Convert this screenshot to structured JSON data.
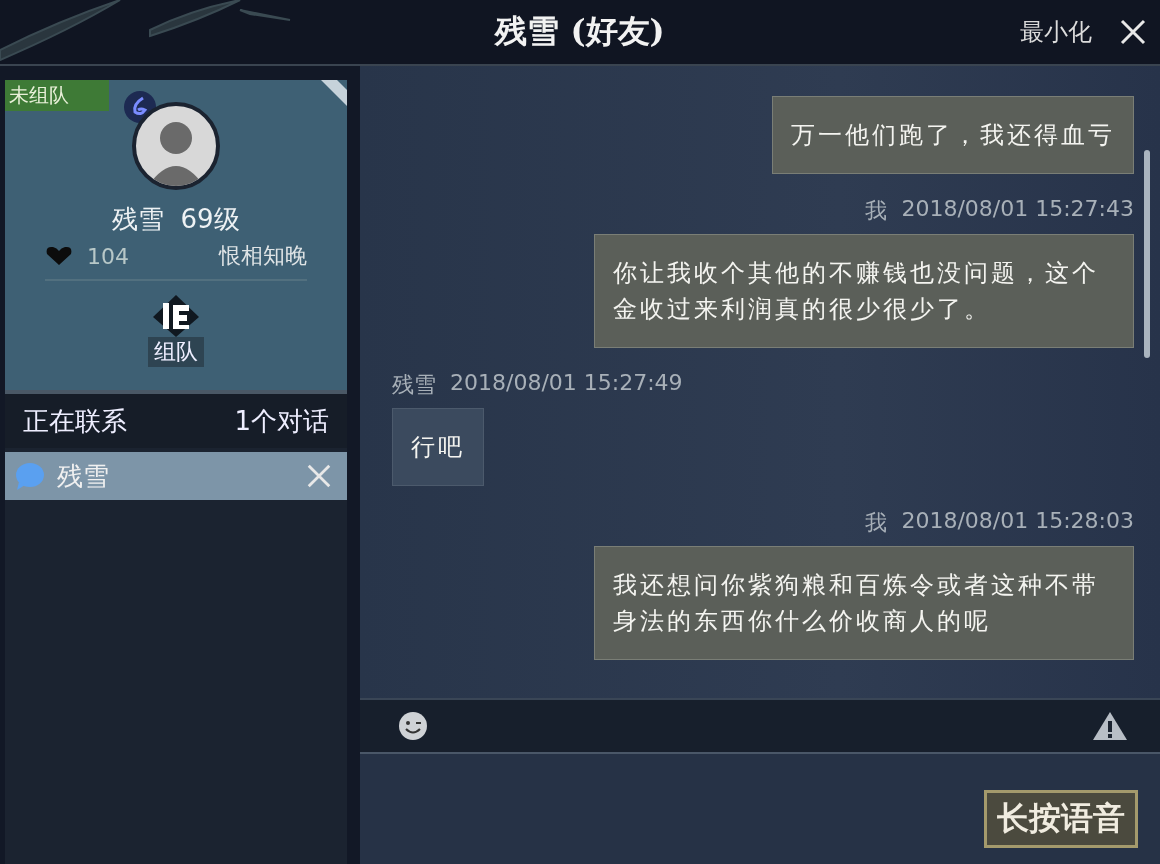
{
  "window": {
    "title": "残雪 (好友)",
    "minimize": "最小化"
  },
  "profile": {
    "team_status": "未组队",
    "name": "残雪",
    "level": "69级",
    "intimacy": "104",
    "relation": "恨相知晚",
    "team_button": "组队"
  },
  "contacts": {
    "heading": "正在联系",
    "count": "1个对话",
    "items": [
      {
        "name": "残雪",
        "selected": true
      }
    ]
  },
  "messages": [
    {
      "kind": "self",
      "text": "万一他们跑了，我还得血亏"
    },
    {
      "kind": "self",
      "sender": "我",
      "time": "2018/08/01  15:27:43",
      "text": "你让我收个其他的不赚钱也没问题，这个金收过来利润真的很少很少了。"
    },
    {
      "kind": "other",
      "sender": "残雪",
      "time": "2018/08/01  15:27:49",
      "text": "行吧"
    },
    {
      "kind": "self",
      "sender": "我",
      "time": "2018/08/01  15:28:03",
      "text": "我还想问你紫狗粮和百炼令或者这种不带身法的东西你什么价收商人的呢"
    }
  ],
  "voice_button": "长按语音"
}
